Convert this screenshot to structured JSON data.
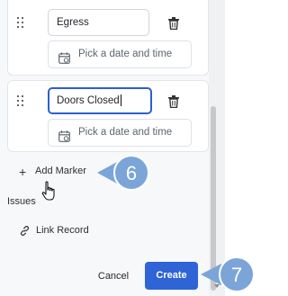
{
  "markers": [
    {
      "name_value": "Egress",
      "date_placeholder": "Pick a date and time"
    },
    {
      "name_value": "Doors Closed",
      "date_placeholder": "Pick a date and time"
    }
  ],
  "add_marker_label": "Add Marker",
  "issues_label": "Issues",
  "link_record_label": "Link Record",
  "footer": {
    "cancel_label": "Cancel",
    "create_label": "Create"
  },
  "callouts": {
    "add_marker_step": "6",
    "create_step": "7"
  },
  "colors": {
    "primary": "#2f64d6",
    "callout": "#7ba5d8",
    "focus_border": "#2d5fce"
  },
  "icons": {
    "drag": "drag-handle-icon",
    "trash": "trash-icon",
    "calendar": "calendar-icon",
    "plus": "plus-icon",
    "link": "link-icon",
    "cursor": "hand-cursor-icon"
  }
}
